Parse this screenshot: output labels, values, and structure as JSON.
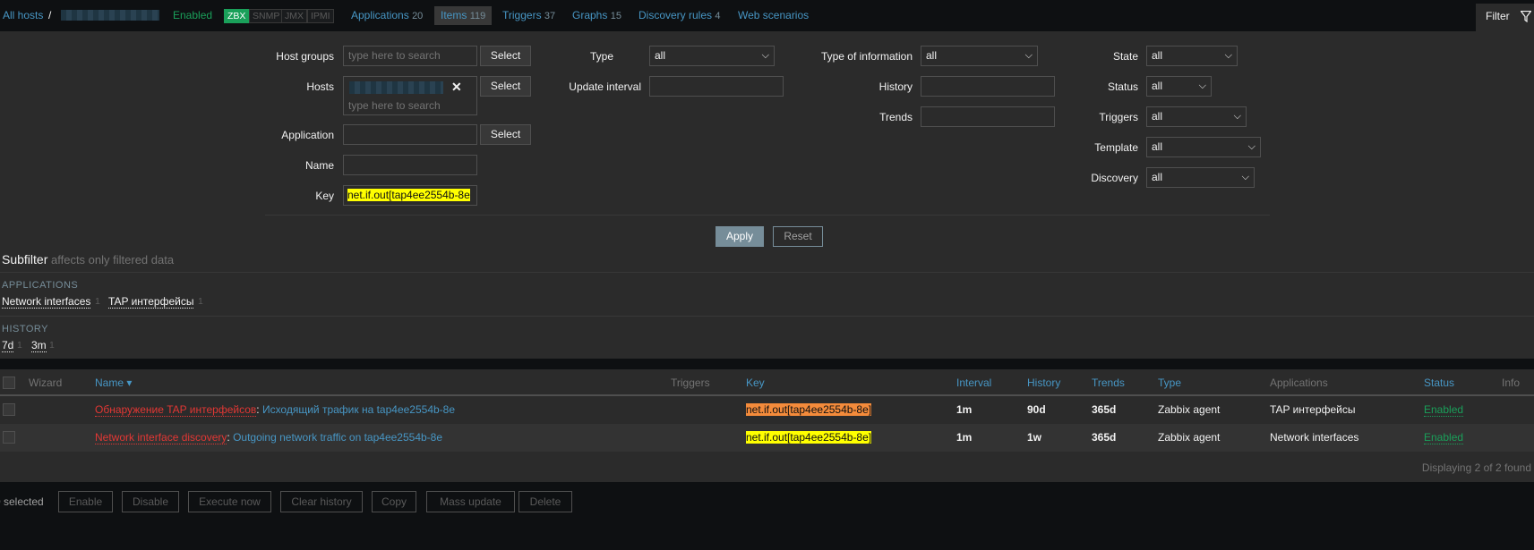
{
  "nav": {
    "all_hosts": "All hosts",
    "slash": "/",
    "enabled": "Enabled",
    "zbx": "ZBX",
    "snmp": "SNMP",
    "jmx": "JMX",
    "ipmi": "IPMI",
    "applications": "Applications",
    "applications_count": "20",
    "items": "Items",
    "items_count": "119",
    "triggers": "Triggers",
    "triggers_count": "37",
    "graphs": "Graphs",
    "graphs_count": "15",
    "discovery": "Discovery rules",
    "discovery_count": "4",
    "web": "Web scenarios",
    "filter_tab": "Filter"
  },
  "filter": {
    "host_groups_label": "Host groups",
    "host_groups_placeholder": "type here to search",
    "hosts_label": "Hosts",
    "hosts_placeholder": "type here to search",
    "application_label": "Application",
    "name_label": "Name",
    "key_label": "Key",
    "key_value": "net.if.out[tap4ee2554b-8e",
    "select_label": "Select",
    "type_label": "Type",
    "type_value": "all",
    "update_interval_label": "Update interval",
    "type_info_label": "Type of information",
    "type_info_value": "all",
    "history_label": "History",
    "trends_label": "Trends",
    "state_label": "State",
    "state_value": "all",
    "status_label": "Status",
    "status_value": "all",
    "triggers_label": "Triggers",
    "triggers_value": "all",
    "template_label": "Template",
    "template_value": "all",
    "discovery_label": "Discovery",
    "discovery_value": "all",
    "apply": "Apply",
    "reset": "Reset"
  },
  "subfilter": {
    "title": "Subfilter",
    "note": "affects only filtered data",
    "applications_header": "APPLICATIONS",
    "applications": [
      {
        "label": "Network interfaces",
        "count": "1"
      },
      {
        "label": "TAP интерфейсы",
        "count": "1"
      }
    ],
    "history_header": "HISTORY",
    "history": [
      {
        "label": "7d",
        "count": "1"
      },
      {
        "label": "3m",
        "count": "1"
      }
    ]
  },
  "table": {
    "headers": {
      "wizard": "Wizard",
      "name": "Name ▾",
      "triggers": "Triggers",
      "key": "Key",
      "interval": "Interval",
      "history": "History",
      "trends": "Trends",
      "type": "Type",
      "applications": "Applications",
      "status": "Status",
      "info": "Info"
    },
    "rows": [
      {
        "rule": "Обнаружение TAP интерфейсов",
        "sep": ": ",
        "name": "Исходящий трафик на tap4ee2554b-8e",
        "key": "net.if.out[tap4ee2554b-8e]",
        "interval": "1m",
        "history": "90d",
        "trends": "365d",
        "type": "Zabbix agent",
        "applications": "TAP интерфейсы",
        "status": "Enabled"
      },
      {
        "rule": "Network interface discovery",
        "sep": ": ",
        "name": "Outgoing network traffic on tap4ee2554b-8e",
        "key": "net.if.out[tap4ee2554b-8e]",
        "interval": "1m",
        "history": "1w",
        "trends": "365d",
        "type": "Zabbix agent",
        "applications": "Network interfaces",
        "status": "Enabled"
      }
    ],
    "footer": "Displaying 2 of 2 found"
  },
  "actions": {
    "selected": "0 selected",
    "enable": "Enable",
    "disable": "Disable",
    "execute_now": "Execute now",
    "clear_history": "Clear history",
    "copy": "Copy",
    "mass_update": "Mass update",
    "delete": "Delete"
  }
}
